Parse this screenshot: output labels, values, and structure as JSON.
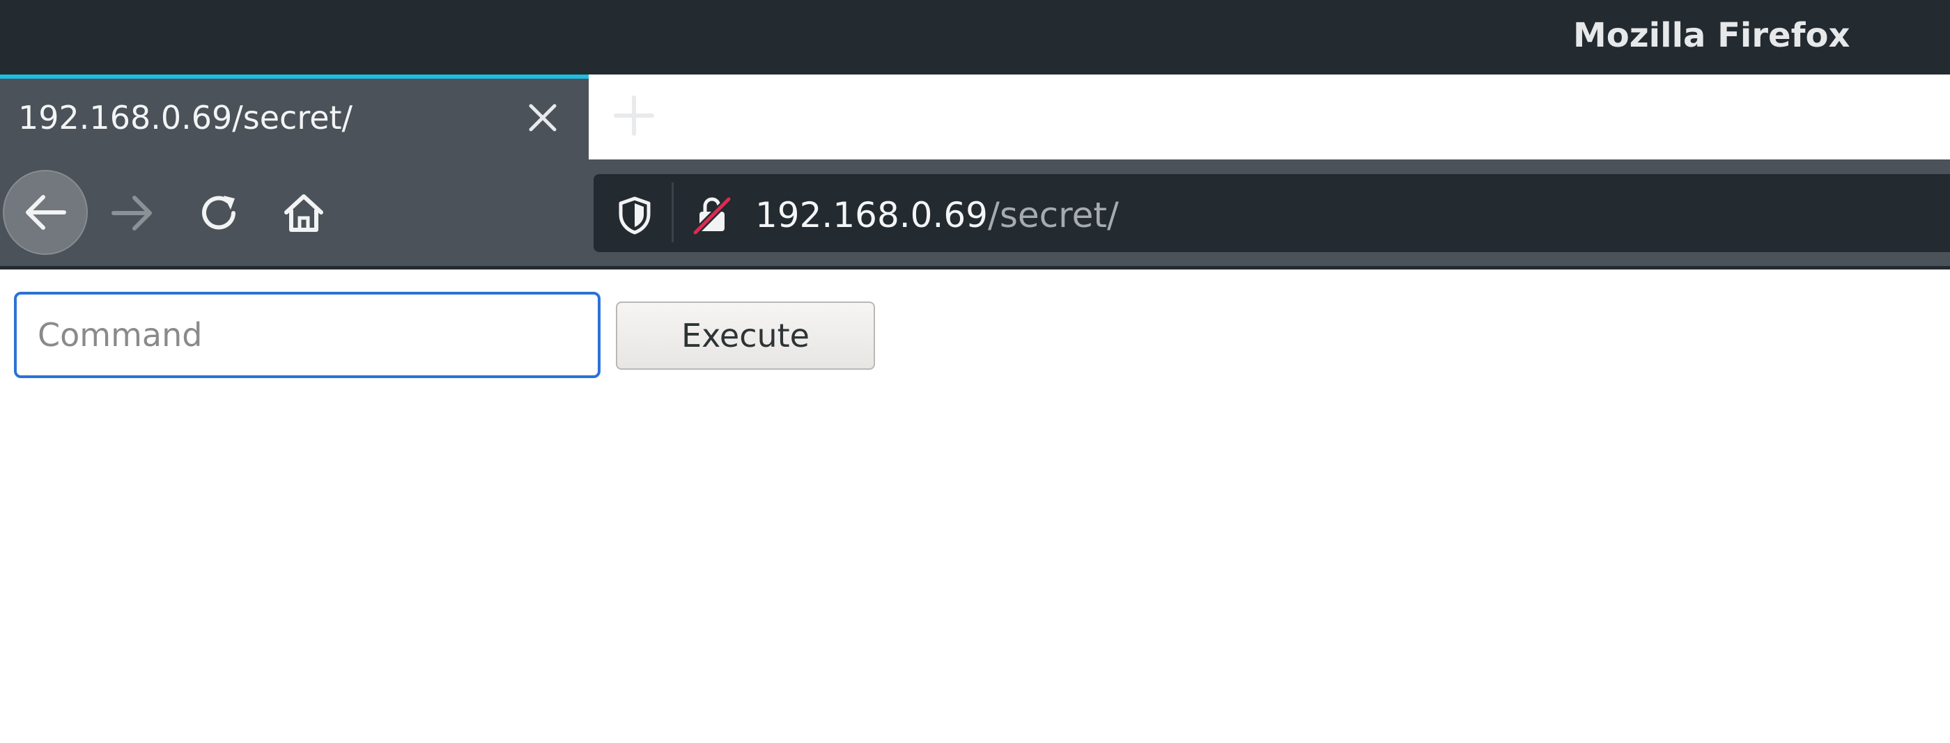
{
  "window": {
    "title": "Mozilla Firefox"
  },
  "tab": {
    "title": "192.168.0.69/secret/",
    "close_icon": "close-icon",
    "accent_color": "#20bde0"
  },
  "toolbar": {
    "new_tab_icon": "plus-icon",
    "back_icon": "arrow-left-icon",
    "forward_icon": "arrow-right-icon",
    "reload_icon": "reload-icon",
    "home_icon": "home-icon"
  },
  "urlbar": {
    "shield_icon": "shield-icon",
    "insecure_icon": "insecure-lock-icon",
    "host": "192.168.0.69",
    "path": "/secret/"
  },
  "page": {
    "command_input": {
      "value": "",
      "placeholder": "Command"
    },
    "execute_button_label": "Execute",
    "focus_color": "#2b73d6"
  }
}
